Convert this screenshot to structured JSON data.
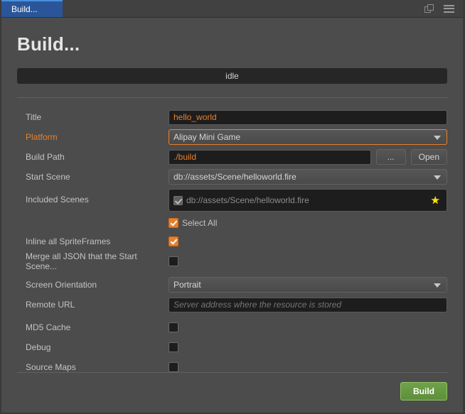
{
  "window": {
    "tab_label": "Build...",
    "icons": {
      "copy": "copy-panel-icon",
      "menu": "hamburger-menu-icon"
    }
  },
  "header": {
    "title": "Build...",
    "status": "idle"
  },
  "form": {
    "title": {
      "label": "Title",
      "value": "hello_world"
    },
    "platform": {
      "label": "Platform",
      "value": "Alipay Mini Game"
    },
    "build_path": {
      "label": "Build Path",
      "value": "./build",
      "browse_label": "...",
      "open_label": "Open"
    },
    "start_scene": {
      "label": "Start Scene",
      "value": "db://assets/Scene/helloworld.fire"
    },
    "included_scenes": {
      "label": "Included Scenes",
      "scene": "db://assets/Scene/helloworld.fire",
      "star": "★",
      "select_all_label": "Select All"
    },
    "inline_spriteframes": {
      "label": "Inline all SpriteFrames"
    },
    "merge_json": {
      "label": "Merge all JSON that the Start Scene..."
    },
    "screen_orientation": {
      "label": "Screen Orientation",
      "value": "Portrait"
    },
    "remote_url": {
      "label": "Remote URL",
      "placeholder": "Server address where the resource is stored",
      "value": ""
    },
    "md5_cache": {
      "label": "MD5 Cache"
    },
    "debug": {
      "label": "Debug"
    },
    "source_maps": {
      "label": "Source Maps"
    }
  },
  "footer": {
    "build_label": "Build"
  },
  "colors": {
    "accent_orange": "#e8802a",
    "tab_blue": "#2a5699",
    "build_green": "#5e8f3c",
    "star_yellow": "#f5e400",
    "panel_bg": "#4c4c4c",
    "input_bg": "#1d1d1d"
  }
}
